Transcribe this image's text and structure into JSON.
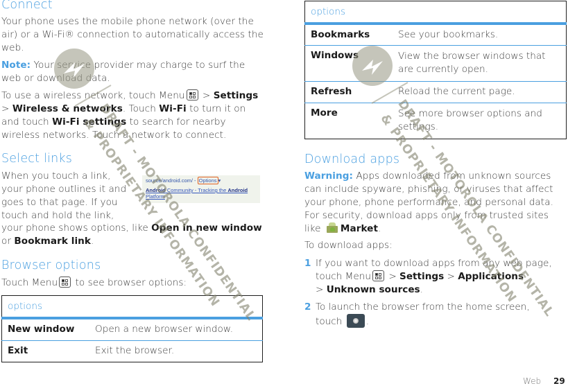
{
  "left": {
    "connect": {
      "heading": "Connect",
      "intro": "Your phone uses the mobile phone network (over the air) or a Wi-Fi® connection to automatically access the web.",
      "note_label": "Note:",
      "note_text": " Your service provider may charge to surf the web or download data.",
      "wireless": {
        "t1": "To use a wireless network, touch Menu",
        "t2": " > ",
        "settings": "Settings",
        "t3": " > ",
        "wireless_networks": "Wireless & networks",
        "t4": ". Touch ",
        "wifi": "Wi-Fi",
        "t5": " to turn it on and touch ",
        "wifi_settings": "Wi-Fi settings",
        "t6": " to search for nearby wireless networks. Touch a network to connect."
      }
    },
    "select_links": {
      "heading": "Select links",
      "t1": "When you touch a link, your phone outlines it and goes to that page. If you touch and hold the link, your phone shows options, like ",
      "open_new_window": "Open in new window",
      "t2": " or ",
      "bookmark_link": "Bookmark link",
      "t3": ".",
      "screenshot": {
        "url": "source/android.com/ -",
        "options_label": "Options",
        "arrow": "▾",
        "link_bold1": "Android",
        "link_mid": " Community - Tracking the ",
        "link_bold2": "Android",
        "link_end": "Platform"
      }
    },
    "browser_options": {
      "heading": "Browser options",
      "t1": "Touch Menu",
      "t2": " to see browser options:",
      "table": {
        "header": "options",
        "rows": [
          {
            "key": "New window",
            "desc": "Open a new browser window."
          },
          {
            "key": "Exit",
            "desc": "Exit the browser."
          }
        ]
      }
    }
  },
  "right": {
    "table": {
      "header": "options",
      "rows": [
        {
          "key": "Bookmarks",
          "desc": "See your bookmarks."
        },
        {
          "key": "Windows",
          "desc": "View the browser windows that are currently open."
        },
        {
          "key": "Refresh",
          "desc": "Reload the current page."
        },
        {
          "key": "More",
          "desc": "See more browser options and settings."
        }
      ]
    },
    "download_apps": {
      "heading": "Download apps",
      "warning_label": "Warning:",
      "warning_text": " Apps downloaded from unknown sources can include spyware, phishing, or viruses that affect your phone, phone performance, and personal data. For security, download apps only from trusted sites like ",
      "market": "Market",
      "period": ".",
      "to_download": "To download apps:",
      "steps": [
        {
          "num": "1",
          "t1": "If you want to download apps from any web page, touch Menu",
          "t2": " > ",
          "settings": "Settings",
          "t3": " > ",
          "applications": "Applications",
          "t4": " > ",
          "unknown_sources": "Unknown sources",
          "t5": "."
        },
        {
          "num": "2",
          "t1": "To launch the browser from the home screen, touch",
          "t2": "."
        }
      ]
    }
  },
  "footer": {
    "section": "Web",
    "page": "29"
  },
  "watermark": {
    "line1": "DRAFT - MOTOROLA CONFIDENTIAL",
    "line2": "& PROPRIETARY INFORMATION"
  },
  "colors": {
    "accent": "#4a9fe0",
    "table_border": "#1e1e1e",
    "highlight_outline": "#e06020"
  }
}
